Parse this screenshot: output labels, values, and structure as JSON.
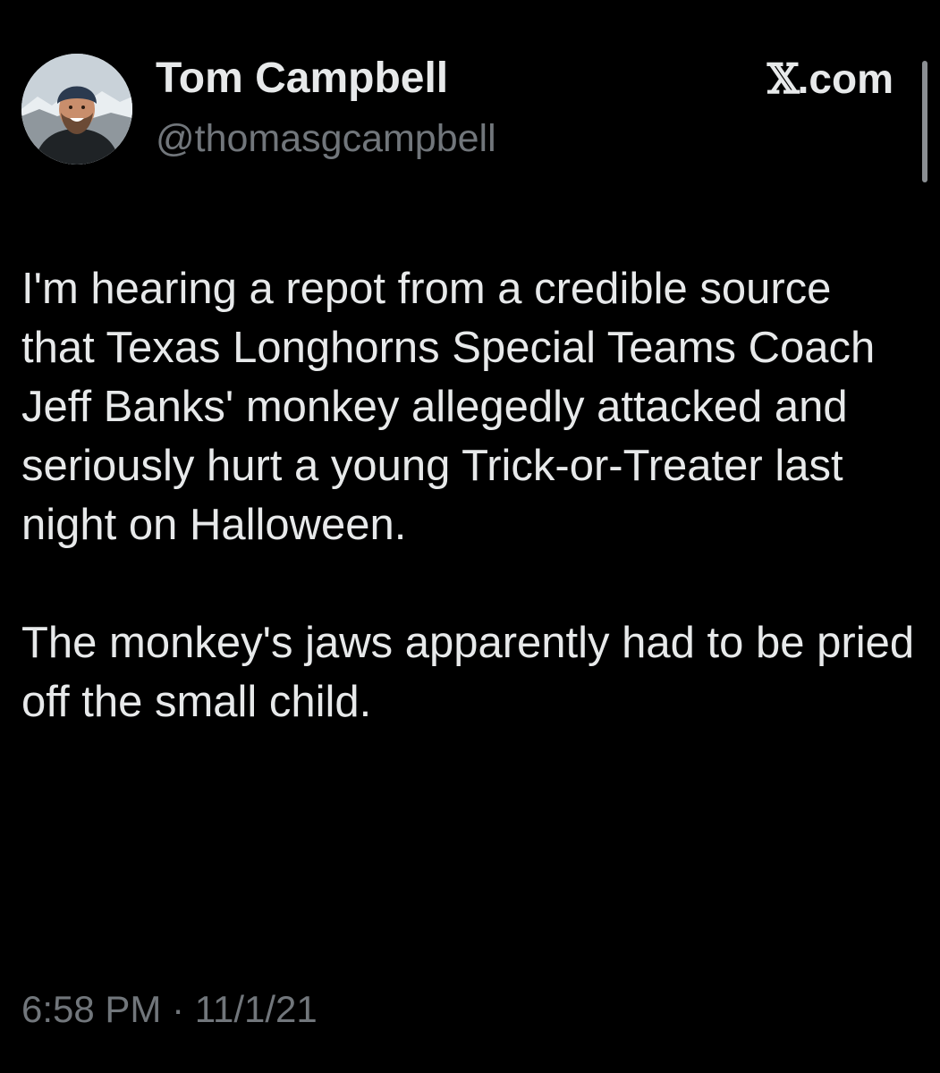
{
  "author": {
    "display_name": "Tom Campbell",
    "handle": "@thomasgcampbell",
    "avatar_icon": "profile-photo"
  },
  "source": {
    "glyph": "𝕏",
    "label": ".com"
  },
  "tweet": {
    "paragraphs": [
      "I'm hearing a repot from a credible source that Texas Longhorns Special Teams Coach Jeff Banks' monkey allegedly attacked and seriously hurt a young Trick-or-Treater last night on Halloween.",
      "The monkey's jaws  apparently had to be pried off the small child."
    ],
    "time": "6:58 PM",
    "separator": "·",
    "date": "11/1/21"
  },
  "colors": {
    "background": "#000000",
    "primary_text": "#e7e9ea",
    "secondary_text": "#71767b"
  }
}
